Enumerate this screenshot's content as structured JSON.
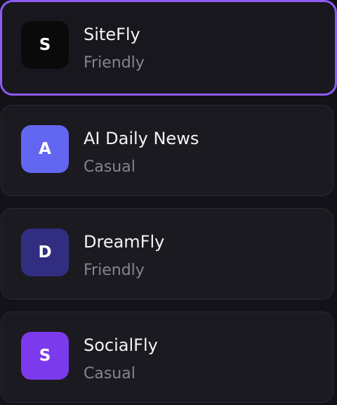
{
  "agents": [
    {
      "name": "SiteFly",
      "tone": "Friendly",
      "avatar_letter": "S",
      "avatar_color": "#0a0a0b",
      "selected": true
    },
    {
      "name": "AI Daily News",
      "tone": "Casual",
      "avatar_letter": "A",
      "avatar_color": "#6366f1",
      "selected": false
    },
    {
      "name": "DreamFly",
      "tone": "Friendly",
      "avatar_letter": "D",
      "avatar_color": "#312e81",
      "selected": false
    },
    {
      "name": "SocialFly",
      "tone": "Casual",
      "avatar_letter": "S",
      "avatar_color": "#7c3aed",
      "selected": false
    }
  ],
  "colors": {
    "selected_border": "#8b5cf6",
    "card_background": "#1b1a20",
    "page_background": "#131218"
  }
}
